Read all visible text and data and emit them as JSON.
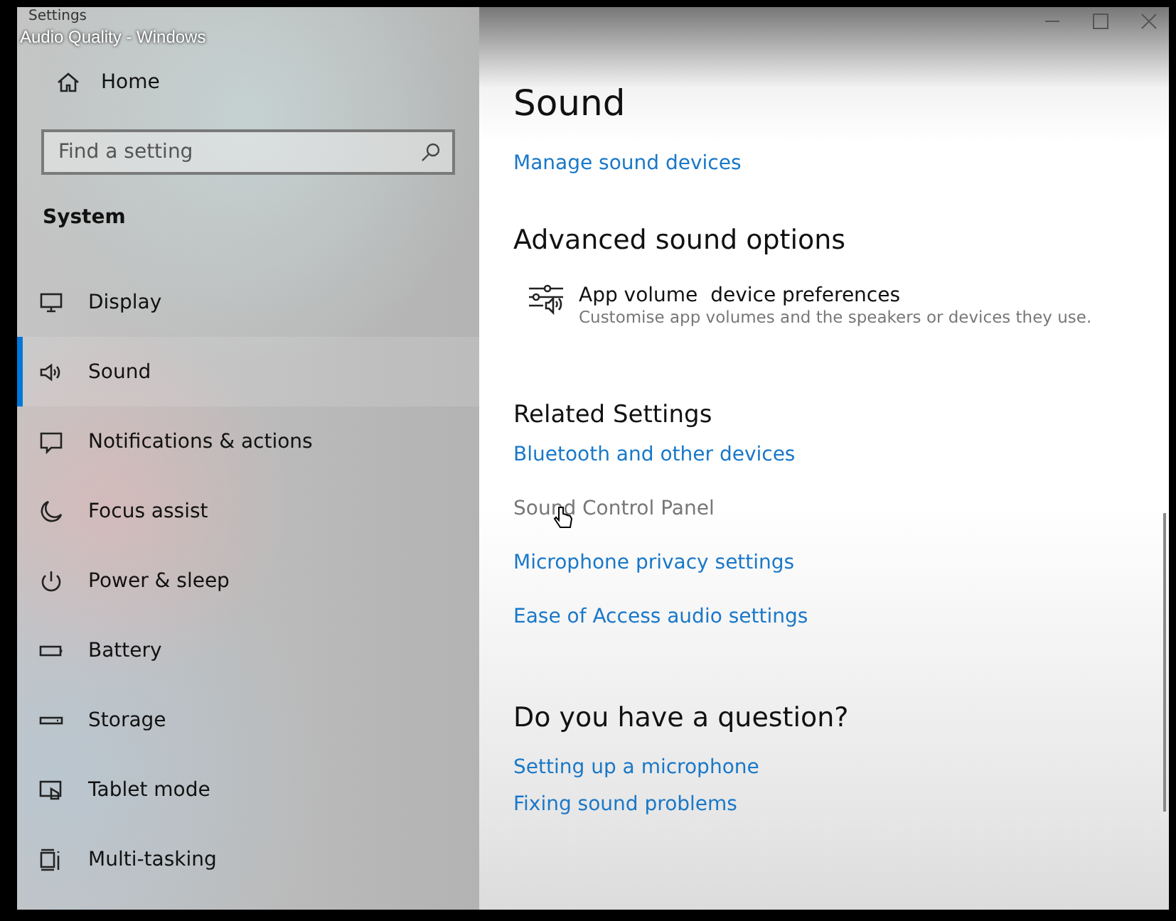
{
  "video_title": "Audio Quality - Windows",
  "window": {
    "title": "Settings"
  },
  "sidebar": {
    "home": "Home",
    "search": {
      "placeholder": "Find a setting"
    },
    "section": "System",
    "items": [
      {
        "label": "Display",
        "selected": false
      },
      {
        "label": "Sound",
        "selected": true
      },
      {
        "label": "Notifications & actions",
        "selected": false
      },
      {
        "label": "Focus assist",
        "selected": false
      },
      {
        "label": "Power & sleep",
        "selected": false
      },
      {
        "label": "Battery",
        "selected": false
      },
      {
        "label": "Storage",
        "selected": false
      },
      {
        "label": "Tablet mode",
        "selected": false
      },
      {
        "label": "Multi-tasking",
        "selected": false
      }
    ]
  },
  "content": {
    "title": "Sound",
    "top_link": {
      "label": "Manage sound devices",
      "hovered": false
    },
    "advanced": {
      "heading": "Advanced sound options",
      "item": {
        "title": "App volume  device preferences",
        "description": "Customise app volumes and the speakers or devices they use."
      }
    },
    "related": {
      "heading": "Related Settings",
      "links": [
        {
          "label": "Bluetooth and other devices",
          "hovered": false
        },
        {
          "label": "Sound Control Panel",
          "hovered": true
        },
        {
          "label": "Microphone privacy settings",
          "hovered": false
        },
        {
          "label": "Ease of Access audio settings",
          "hovered": false
        }
      ]
    },
    "question": {
      "heading": "Do you have a question?",
      "links": [
        {
          "label": "Setting up a microphone",
          "hovered": false
        },
        {
          "label": "Fixing sound problems",
          "hovered": false
        }
      ]
    }
  }
}
